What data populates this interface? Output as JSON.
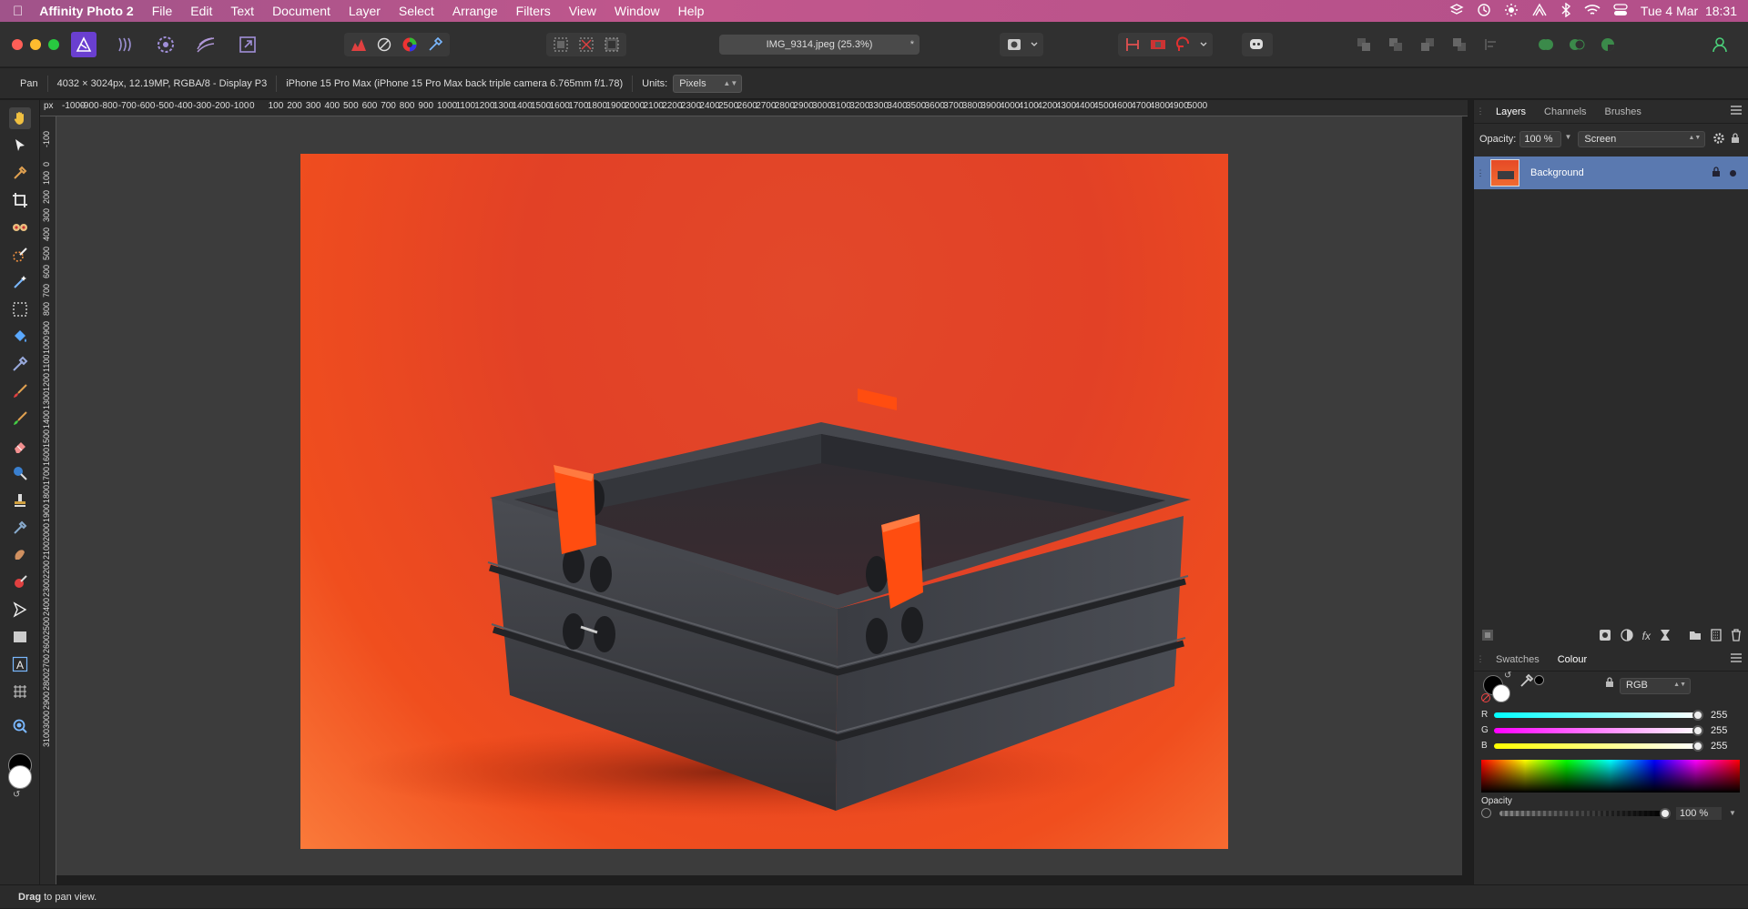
{
  "menubar": {
    "app": "Affinity Photo 2",
    "items": [
      "File",
      "Edit",
      "Text",
      "Document",
      "Layer",
      "Select",
      "Arrange",
      "Filters",
      "View",
      "Window",
      "Help"
    ],
    "clock": "Tue 4 Mar  18:31"
  },
  "toolbar": {
    "doc_title": "IMG_9314.jpeg (25.3%)",
    "modified": "*"
  },
  "context": {
    "tool": "Pan",
    "doc_info": "4032 × 3024px, 12.19MP, RGBA/8 - Display P3",
    "camera": "iPhone 15 Pro Max (iPhone 15 Pro Max back triple camera 6.765mm f/1.78)",
    "units_label": "Units:",
    "units_value": "Pixels"
  },
  "ruler": {
    "unit": "px",
    "top": [
      "-1000",
      "-900",
      "-800",
      "-700",
      "-600",
      "-500",
      "-400",
      "-300",
      "-200",
      "-100",
      "0",
      "100",
      "200",
      "300",
      "400",
      "500",
      "600",
      "700",
      "800",
      "900",
      "1000",
      "1100",
      "1200",
      "1300",
      "1400",
      "1500",
      "1600",
      "1700",
      "1800",
      "1900",
      "2000",
      "2100",
      "2200",
      "2300",
      "2400",
      "2500",
      "2600",
      "2700",
      "2800",
      "2900",
      "3000",
      "3100",
      "3200",
      "3300",
      "3400",
      "3500",
      "3600",
      "3700",
      "3800",
      "3900",
      "4000",
      "4100",
      "4200",
      "4300",
      "4400",
      "4500",
      "4600",
      "4700",
      "4800",
      "4900",
      "5000"
    ],
    "left": [
      "-100",
      "0",
      "100",
      "200",
      "300",
      "400",
      "500",
      "600",
      "700",
      "800",
      "900",
      "1000",
      "1100",
      "1200",
      "1300",
      "1400",
      "1500",
      "1600",
      "1700",
      "1800",
      "1900",
      "2000",
      "2100",
      "2200",
      "2300",
      "2400",
      "2500",
      "2600",
      "2700",
      "2800",
      "2900",
      "3000",
      "3100"
    ]
  },
  "layers_panel": {
    "tabs": [
      "Layers",
      "Channels",
      "Brushes"
    ],
    "active_tab": "Layers",
    "opacity_label": "Opacity:",
    "opacity_value": "100 %",
    "blend_mode": "Screen",
    "layers": [
      {
        "name": "Background"
      }
    ]
  },
  "colour_panel": {
    "tabs": [
      "Swatches",
      "Colour"
    ],
    "active_tab": "Colour",
    "model": "RGB",
    "r_label": "R",
    "g_label": "G",
    "b_label": "B",
    "r": "255",
    "g": "255",
    "b": "255",
    "opacity_label": "Opacity",
    "opacity_value": "100 %"
  },
  "status": {
    "bold": "Drag",
    "text": " to pan view."
  },
  "colors": {
    "menubar": "#b5548b",
    "accent": "#6a3fd0",
    "selection": "#5a79b0",
    "backdrop": "#e24126",
    "box": "#3a3c40",
    "clip": "#ff4d10"
  }
}
